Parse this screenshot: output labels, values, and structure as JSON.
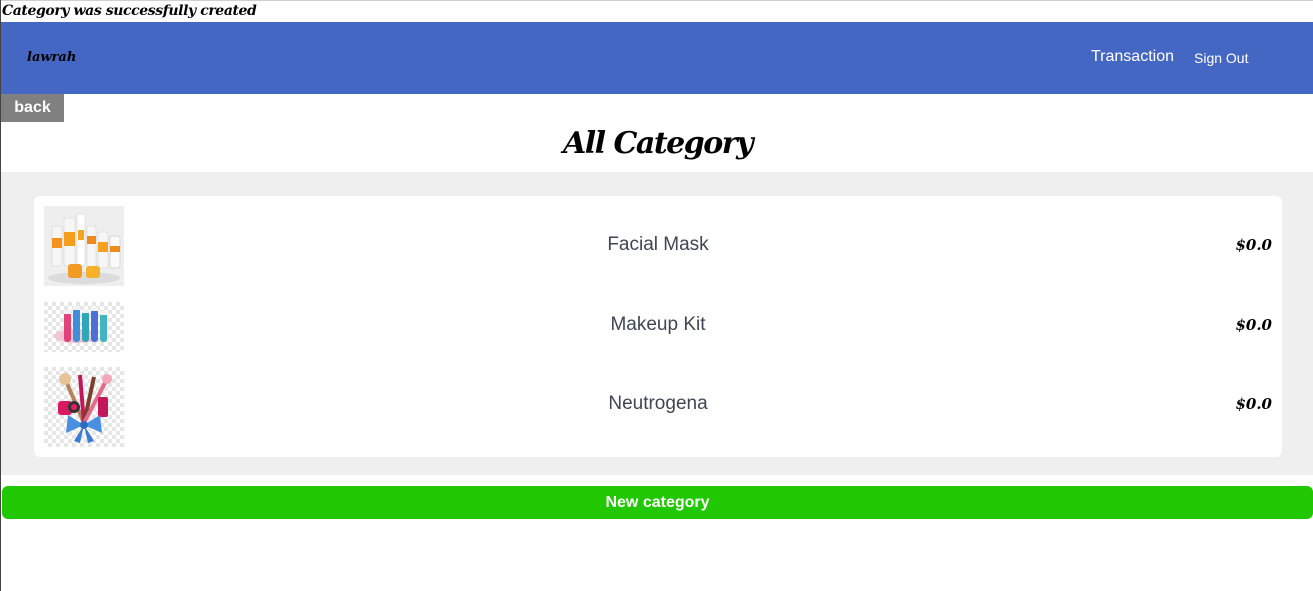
{
  "flash": {
    "message": "Category was successfully created"
  },
  "navbar": {
    "brand": "lawrah",
    "transaction_label": "Transaction",
    "signout_label": "Sign Out",
    "background": "#4467c4"
  },
  "back_label": "back",
  "page_title": "All Category",
  "categories": [
    {
      "name": "Facial Mask",
      "amount": "$0.0",
      "thumbnail": "skincare-products-photo"
    },
    {
      "name": "Makeup Kit",
      "amount": "$0.0",
      "thumbnail": "makeup-bottles-photo"
    },
    {
      "name": "Neutrogena",
      "amount": "$0.0",
      "thumbnail": "cosmetics-bouquet-photo"
    }
  ],
  "new_category_label": "New category",
  "colors": {
    "accent_green": "#21c700",
    "back_gray": "#808080",
    "content_bg": "#efefef"
  }
}
